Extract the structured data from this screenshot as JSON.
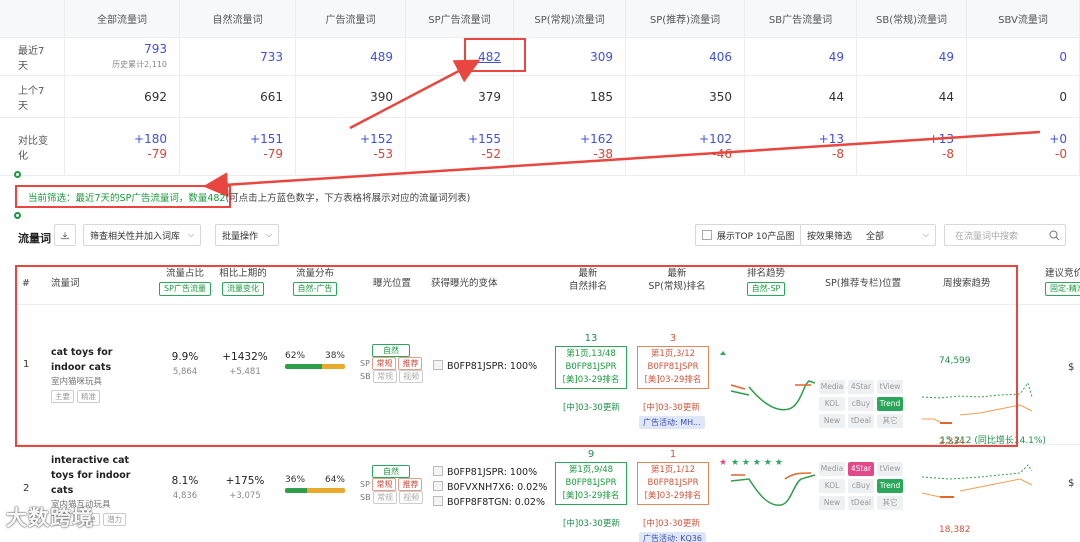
{
  "summary": {
    "headers": [
      "全部流量词",
      "自然流量词",
      "广告流量词",
      "SP广告流量词",
      "SP(常规)流量词",
      "SP(推荐)流量词",
      "SB广告流量词",
      "SB(常规)流量词",
      "SBV流量词"
    ],
    "rows": [
      {
        "label": "最近7天",
        "values": [
          "793",
          "733",
          "489",
          "482",
          "309",
          "406",
          "49",
          "49",
          "0"
        ],
        "note": "历史累计2,110"
      },
      {
        "label": "上个7天",
        "values": [
          "692",
          "661",
          "390",
          "379",
          "185",
          "350",
          "44",
          "44",
          "0"
        ]
      },
      {
        "label": "对比变化",
        "up": [
          "+180",
          "+151",
          "+152",
          "+155",
          "+162",
          "+102",
          "+13",
          "+13",
          "+0"
        ],
        "down": [
          "-79",
          "-79",
          "-53",
          "-52",
          "-38",
          "-46",
          "-8",
          "-8",
          "-0"
        ]
      }
    ]
  },
  "filter": {
    "label": "当前筛选：",
    "value": "最近7天的SP广告流量词，数量482",
    "hint": "(可点击上方蓝色数字，下方表格将展示对应的流量词列表)"
  },
  "toolbar": {
    "title": "流量词",
    "relevance_btn": "筛查相关性并加入词库",
    "batch_btn": "批量操作",
    "top10_label": "展示TOP 10产品图",
    "effect_filter_label": "按效果筛选",
    "effect_filter_value": "全部",
    "search_placeholder": "在流量词中搜索"
  },
  "table": {
    "headers": {
      "index": "#",
      "keyword": "流量词",
      "share": "流量占比",
      "share_tag": "SP广告流量",
      "vs_prev": "相比上期的",
      "vs_prev_tag": "流量变化",
      "dist": "流量分布",
      "dist_tag": "自然-广告",
      "exposure": "曝光位置",
      "variant": "获得曝光的变体",
      "latest_natural": "最新\n自然排名",
      "latest_sp": "最新\nSP(常规)排名",
      "rank_trend": "排名趋势",
      "rank_trend_tag": "自然-SP",
      "sp_pos": "SP(推荐专栏)位置",
      "weekly_search": "周搜索趋势",
      "suggest": "建议竞价",
      "suggest_tag": "固定-精准"
    },
    "rows": [
      {
        "index": "1",
        "keyword": "cat toys for indoor cats",
        "keyword_cn": "室内猫咪玩具",
        "tags": [
          "主要",
          "精准"
        ],
        "share": "9.9%",
        "share_sub": "5,864",
        "change": "+1432%",
        "change_sub": "+5,481",
        "dist_left": "62%",
        "dist_right": "38%",
        "dist_fraction": 0.62,
        "exposure_natural": "自然",
        "exposure_sp": [
          "常规",
          "推荐"
        ],
        "exposure_sb": [
          "常规",
          "视频"
        ],
        "variants": [
          "B0FP81JSPR: 100%"
        ],
        "natural_rank": "13",
        "natural_rank_lines": [
          "第1页,13/48",
          "B0FP81JSPR",
          "[美]03-29排名",
          "[中]03-30更新"
        ],
        "sp_rank": "3",
        "sp_rank_lines": [
          "第1页,3/12",
          "B0FP81JSPR",
          "[美]03-29排名",
          "[中]03-30更新"
        ],
        "ad_activity": "广告活动: MH...",
        "sp_grid": [
          "Media",
          "4Star",
          "tView",
          "KOL",
          "cBuy",
          "Trend",
          "New",
          "tDeal",
          "其它"
        ],
        "sp_grid_active": [
          "Trend"
        ],
        "search_peak": "74,599",
        "search_low": "2,334"
      },
      {
        "index": "2",
        "keyword": "interactive cat toys for indoor cats",
        "keyword_cn": "室内猫互动玩具",
        "tags": [
          "主要",
          "出单",
          "潜力"
        ],
        "share": "8.1%",
        "share_sub": "4,836",
        "change": "+175%",
        "change_sub": "+3,075",
        "dist_left": "36%",
        "dist_right": "64%",
        "dist_fraction": 0.36,
        "exposure_natural": "自然",
        "exposure_sp": [
          "常规",
          "推荐"
        ],
        "exposure_sb": [
          "常规",
          "视频"
        ],
        "variants": [
          "B0FP81JSPR: 100%",
          "B0FVXNH7X6: 0.02%",
          "B0FP8F8TGN: 0.02%"
        ],
        "natural_rank": "9",
        "natural_rank_lines": [
          "第1页,9/48",
          "B0FP81JSPR",
          "[美]03-29排名",
          "[中]03-30更新"
        ],
        "sp_rank": "1",
        "sp_rank_lines": [
          "第1页,1/12",
          "B0FP81JSPR",
          "[美]03-29排名",
          "[中]03-30更新"
        ],
        "ad_activity": "广告活动: KQ36",
        "sp_grid": [
          "Media",
          "4Star",
          "tView",
          "KOL",
          "cBuy",
          "Trend",
          "New",
          "tDeal",
          "其它"
        ],
        "sp_grid_active": [
          "4Star",
          "Trend"
        ],
        "search_peak": "15,212 (同比增长14.1%)",
        "search_low": "18,382"
      }
    ]
  },
  "watermark": "大数跨境",
  "colors": {
    "accent_blue": "#3f51d8",
    "green": "#1a9a3c",
    "red": "#d0463a",
    "highlight": "#e8463f"
  }
}
